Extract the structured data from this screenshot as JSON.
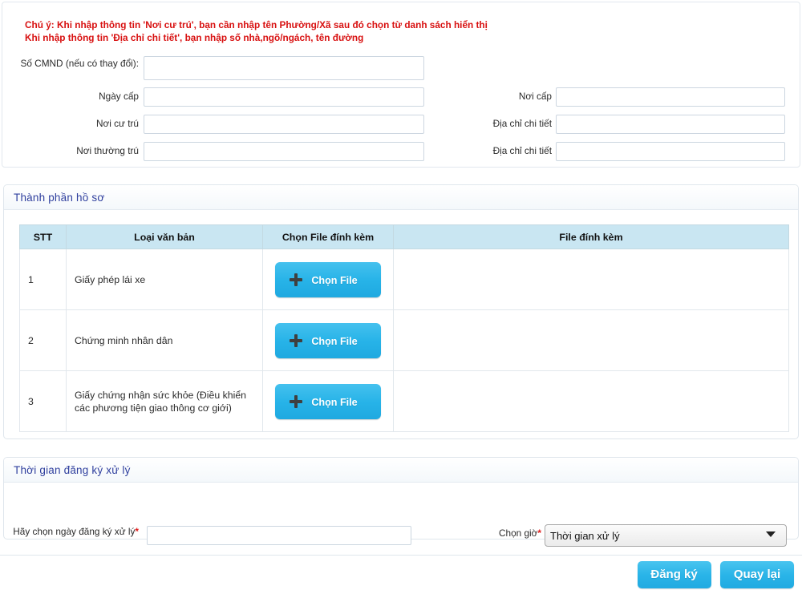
{
  "notice": {
    "line1": "Chú ý: Khi nhập thông tin 'Nơi cư trú', bạn cần nhập tên Phường/Xã sau đó chọn từ danh sách hiển thị",
    "line2": "Khi nhập thông tin 'Địa chỉ chi tiết', bạn nhập số nhà,ngõ/ngách, tên đường"
  },
  "form": {
    "fields": [
      {
        "label": "Số CMND (nếu có thay đổi):",
        "value": "",
        "placeholder": ""
      },
      {
        "label": "Ngày cấp",
        "value": "",
        "placeholder": ""
      },
      {
        "label": "Nơi cư trú",
        "value": "",
        "placeholder": ""
      },
      {
        "label": "Nơi thường trú",
        "value": "",
        "placeholder": ""
      },
      {
        "label": "Nơi cấp",
        "value": "",
        "placeholder": ""
      },
      {
        "label": "Địa chỉ chi tiết",
        "value": "",
        "placeholder": ""
      },
      {
        "label": "Địa chỉ chi tiết",
        "value": "",
        "placeholder": ""
      }
    ]
  },
  "docs_section": {
    "title": "Thành phần hồ sơ",
    "columns": {
      "stt": "STT",
      "type": "Loại văn bản",
      "pick": "Chọn File đính kèm",
      "file": "File đính kèm"
    },
    "pick_button_label": "Chọn File",
    "rows": [
      {
        "stt": "1",
        "type": "Giấy phép lái xe",
        "file": ""
      },
      {
        "stt": "2",
        "type": "Chứng minh nhân dân",
        "file": ""
      },
      {
        "stt": "3",
        "type": "Giấy chứng nhận sức khỏe (Điều khiển các phương tiện giao thông cơ giới)",
        "file": ""
      }
    ]
  },
  "time_section": {
    "title": "Thời gian đăng ký xử lý",
    "date_label": "Hãy chọn ngày đăng ký xử lý",
    "date_value": "",
    "date_placeholder": "",
    "hour_label": "Chọn giờ",
    "hour_selected": "Thời gian xử lý",
    "required_mark": "*"
  },
  "footer": {
    "submit_label": "Đăng ký",
    "back_label": "Quay lại"
  },
  "colors": {
    "accent_blue": "#29b4e8",
    "header_text": "#2f3f9e",
    "notice_red": "#d81111",
    "table_header_bg": "#c9e6f2"
  }
}
